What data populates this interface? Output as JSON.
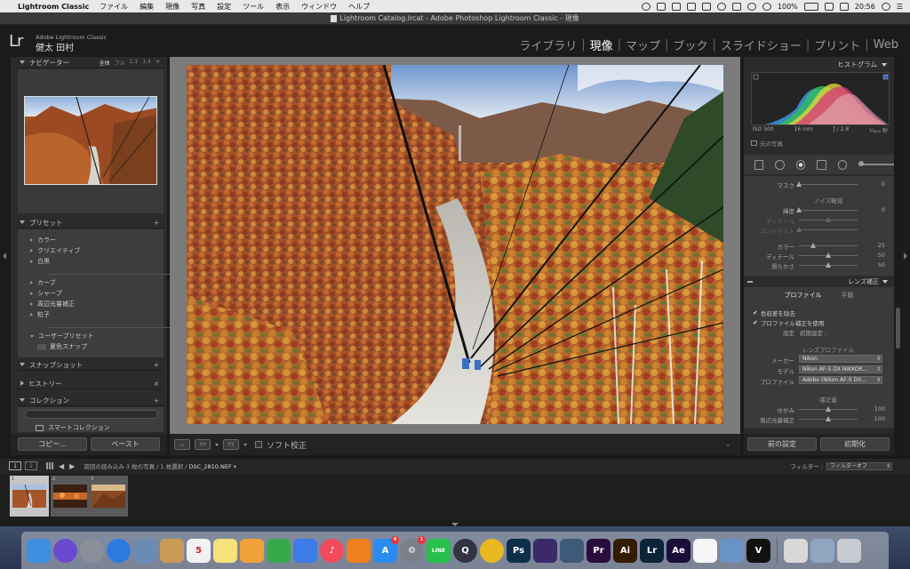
{
  "menubar": {
    "app_name": "Lightroom Classic",
    "items": [
      "ファイル",
      "編集",
      "現像",
      "写真",
      "設定",
      "ツール",
      "表示",
      "ウィンドウ",
      "ヘルプ"
    ],
    "battery": "100%",
    "time": "20:56"
  },
  "window": {
    "title": "Lightroom Catalog.lrcat - Adobe Photoshop Lightroom Classic - 現像"
  },
  "identity": {
    "logo": "Lr",
    "product": "Adobe Lightroom Classic",
    "user": "健太 田村"
  },
  "modules": {
    "library": "ライブラリ",
    "develop": "現像",
    "map": "マップ",
    "book": "ブック",
    "slideshow": "スライドショー",
    "print": "プリント",
    "web": "Web",
    "active": "develop"
  },
  "left": {
    "navigator": {
      "title": "ナビゲーター",
      "zoom": [
        "全体",
        "フル",
        "1:1",
        "1:4"
      ],
      "zoom_extra": "≑"
    },
    "presets": {
      "title": "プリセット",
      "add": "+",
      "group1": [
        "カラー",
        "クリエイティブ",
        "白黒"
      ],
      "group2": [
        "カーブ",
        "シャープ",
        "周辺光量補正",
        "粒子"
      ],
      "user": "ユーザープリセット",
      "user_item": "夏色スナップ"
    },
    "snapshots": {
      "title": "スナップショット",
      "add": "+"
    },
    "history": {
      "title": "ヒストリー",
      "clear": "×"
    },
    "collections": {
      "title": "コレクション",
      "add": "+",
      "smart": "スマートコレクション"
    },
    "copy_button": "コピー...",
    "paste_button": "ペースト"
  },
  "toolbar": {
    "soft_proof": "ソフト校正"
  },
  "right": {
    "histogram": {
      "title": "ヒストグラム",
      "iso": "ISO 500",
      "focal": "16 mm",
      "aperture": "ƒ / 2.8",
      "shutter": "¹⁄₃₂₀₀ 秒",
      "original_label": "元の写真"
    },
    "detail": {
      "mask_label": "マスク",
      "mask_value": "0",
      "noise_title": "ノイズ軽減",
      "luminance_label": "輝度",
      "luminance_value": "0",
      "l_detail_label": "ディテール",
      "l_contrast_label": "コントラスト",
      "color_label": "カラー",
      "color_value": "25",
      "c_detail_label": "ディテール",
      "c_detail_value": "50",
      "smooth_label": "滑らかさ",
      "smooth_value": "50"
    },
    "lens": {
      "title": "レンズ補正",
      "tab_profile": "プロファイル",
      "tab_manual": "手動",
      "remove_ca": "色収差を除去",
      "enable_profile": "プロファイル補正を使用",
      "setup_label": "設定",
      "setup_value": "初期設定 :",
      "lens_profile_title": "レンズプロファイル",
      "maker_label": "メーカー",
      "maker_value": "Nikon",
      "model_label": "モデル",
      "model_value": "Nikon AF-S DX NIKKOR...",
      "profile_label": "プロファイル",
      "profile_value": "Adobe (Nikon AF-S DX...",
      "amount_title": "補正量",
      "distortion_label": "ゆがみ",
      "distortion_value": "100",
      "vignetting_label": "周辺光量補正",
      "vignetting_value": "100"
    },
    "previous_button": "前の設定",
    "reset_button": "初期化"
  },
  "filmbar": {
    "screen1": "1",
    "screen2": "2",
    "path": "前回の読み込み  3 枚の写真 / 1 枚選択 /",
    "filename": "DSC_2810.NEF",
    "filter_label": "フィルター :",
    "filter_value": "フィルターオフ"
  },
  "filmstrip": {
    "cells": [
      "1",
      "2",
      "3"
    ]
  },
  "dock": {
    "icons": [
      {
        "name": "finder-icon",
        "color": "#3f8fe0",
        "glyph": ""
      },
      {
        "name": "siri-icon",
        "color": "#6a4bd0",
        "glyph": "",
        "round": true
      },
      {
        "name": "launchpad-icon",
        "color": "#8a8f99",
        "glyph": "",
        "round": true
      },
      {
        "name": "safari-icon",
        "color": "#2b7be0",
        "glyph": "",
        "round": true
      },
      {
        "name": "photos-viewer-icon",
        "color": "#6b8bb5",
        "glyph": ""
      },
      {
        "name": "notebook-icon",
        "color": "#c79a55",
        "glyph": ""
      },
      {
        "name": "calendar-icon",
        "color": "#f2f2f2",
        "glyph": "5",
        "dark": true
      },
      {
        "name": "notes-icon",
        "color": "#f5e27a",
        "glyph": ""
      },
      {
        "name": "pages-icon",
        "color": "#f0a13a",
        "glyph": ""
      },
      {
        "name": "numbers-icon",
        "color": "#38a94a",
        "glyph": ""
      },
      {
        "name": "keynote-icon",
        "color": "#3d7be8",
        "glyph": ""
      },
      {
        "name": "music-icon",
        "color": "#f04a5c",
        "glyph": "♪",
        "round": true
      },
      {
        "name": "books-icon",
        "color": "#f07f1e",
        "glyph": ""
      },
      {
        "name": "app-store-icon",
        "color": "#2a8cf0",
        "glyph": "A",
        "badge": "4"
      },
      {
        "name": "system-preferences-icon",
        "color": "#7a7f88",
        "glyph": "⚙",
        "round": true,
        "badge": "1"
      },
      {
        "name": "line-icon",
        "color": "#26c04a",
        "glyph": "LINE"
      },
      {
        "name": "quicktime-icon",
        "color": "#334",
        "glyph": "Q",
        "round": true
      },
      {
        "name": "chrome-icon",
        "color": "#e9b81e",
        "glyph": "",
        "round": true
      },
      {
        "name": "photoshop-icon",
        "color": "#0e2f4a",
        "glyph": "Ps"
      },
      {
        "name": "premiere-clip-icon",
        "color": "#3a2a6a",
        "glyph": ""
      },
      {
        "name": "fox-app-icon",
        "color": "#3d5a7a",
        "glyph": ""
      },
      {
        "name": "premiere-icon",
        "color": "#2a0c3f",
        "glyph": "Pr"
      },
      {
        "name": "illustrator-icon",
        "color": "#331c00",
        "glyph": "Ai"
      },
      {
        "name": "lightroom-icon",
        "color": "#0b2538",
        "glyph": "Lr"
      },
      {
        "name": "after-effects-icon",
        "color": "#1a0e3a",
        "glyph": "Ae"
      },
      {
        "name": "textedit-icon",
        "color": "#f5f5f5",
        "glyph": ""
      },
      {
        "name": "preview-icon",
        "color": "#6a93c5",
        "glyph": ""
      },
      {
        "name": "nikon-viewnx-icon",
        "color": "#111",
        "glyph": "V"
      },
      {
        "name": "paper-app-icon",
        "color": "#d8d8d8",
        "glyph": ""
      },
      {
        "name": "image-capture-icon",
        "color": "#8fa6c0",
        "glyph": ""
      },
      {
        "name": "trash-icon",
        "color": "#c8ccd2",
        "glyph": ""
      }
    ]
  }
}
